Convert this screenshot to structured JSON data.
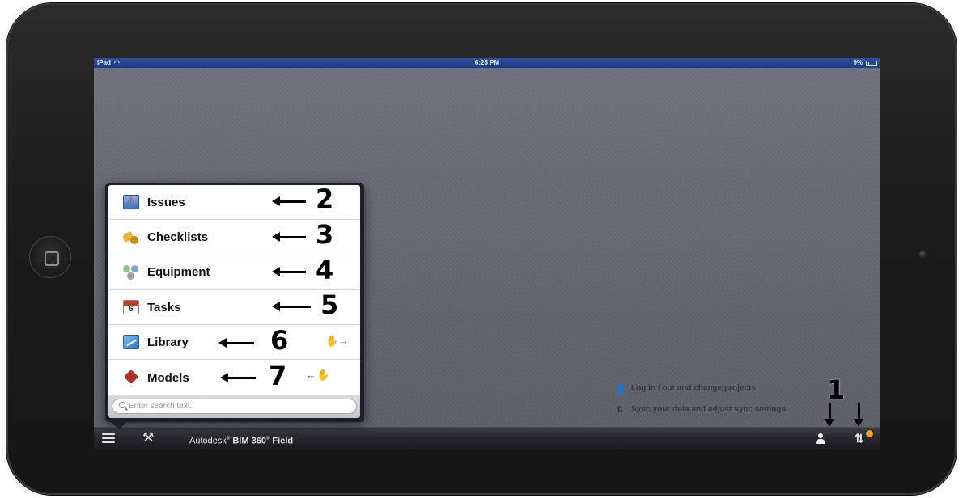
{
  "status_bar": {
    "device": "iPad",
    "time": "6:25 PM",
    "battery": "9%"
  },
  "menu": {
    "items": [
      {
        "label": "Issues",
        "icon": "issues-icon",
        "annotation": "2"
      },
      {
        "label": "Checklists",
        "icon": "checklists-icon",
        "annotation": "3"
      },
      {
        "label": "Equipment",
        "icon": "equipment-icon",
        "annotation": "4"
      },
      {
        "label": "Tasks",
        "icon": "tasks-icon",
        "annotation": "5"
      },
      {
        "label": "Library",
        "icon": "library-icon",
        "annotation": "6"
      },
      {
        "label": "Models",
        "icon": "models-icon",
        "annotation": "7"
      }
    ],
    "search_placeholder": "Enter search text."
  },
  "toolbar": {
    "brand": "Autodesk",
    "product": "BIM 360",
    "product_suffix": "Field"
  },
  "hints": {
    "login": "Log in / out and change projects",
    "sync": "Sync your data and adjust sync settings"
  },
  "annotation_1": "1",
  "colors": {
    "accent_badge": "#f0a020",
    "status_bar": "#2d4f9c"
  }
}
